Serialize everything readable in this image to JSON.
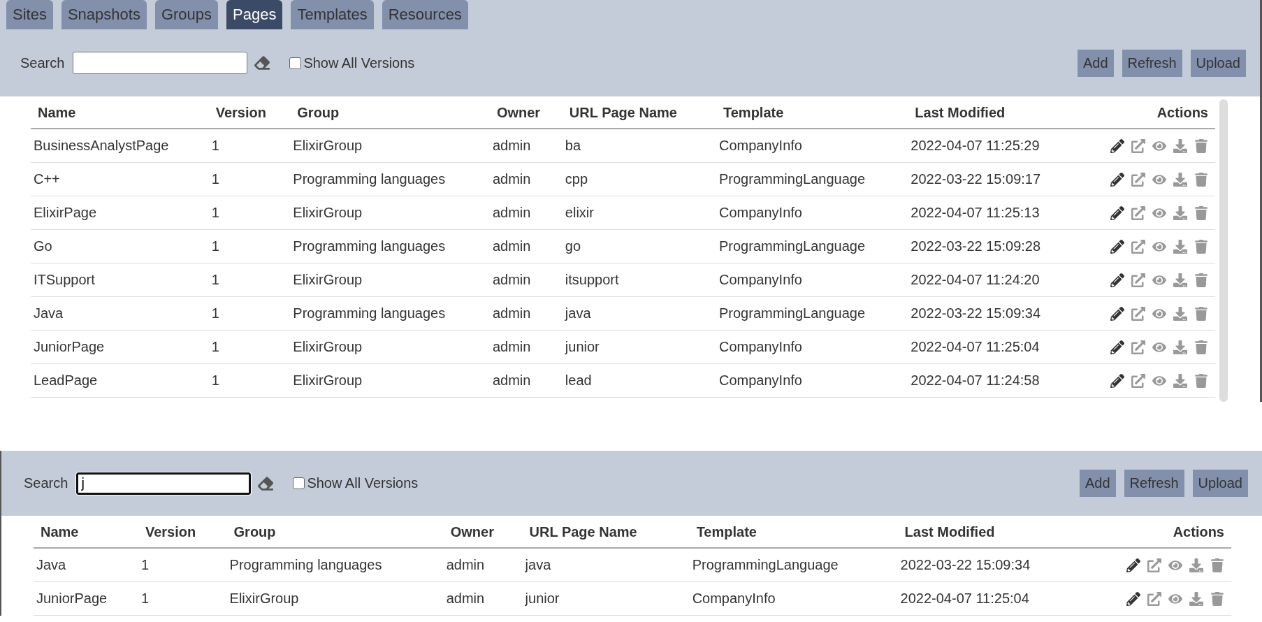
{
  "tabs": [
    {
      "label": "Sites",
      "selected": false
    },
    {
      "label": "Snapshots",
      "selected": false
    },
    {
      "label": "Groups",
      "selected": false
    },
    {
      "label": "Pages",
      "selected": true
    },
    {
      "label": "Templates",
      "selected": false
    },
    {
      "label": "Resources",
      "selected": false
    }
  ],
  "panels": [
    {
      "search_label": "Search",
      "search": {
        "focused": false
      },
      "show_all": {
        "label": "Show All Versions",
        "checked": false
      },
      "buttons": [
        "Add",
        "Refresh",
        "Upload"
      ],
      "scrollbar": true,
      "columns": [
        "Name",
        "Version",
        "Group",
        "Owner",
        "URL Page Name",
        "Template",
        "Last Modified",
        "Actions"
      ],
      "rows": [
        {
          "cells": [
            "BusinessAnalystPage",
            "1",
            "ElixirGroup",
            "admin",
            "ba",
            "CompanyInfo",
            "2022-04-07 11:25:29"
          ]
        },
        {
          "cells": [
            "C++",
            "1",
            "Programming languages",
            "admin",
            "cpp",
            "ProgrammingLanguage",
            "2022-03-22 15:09:17"
          ]
        },
        {
          "cells": [
            "ElixirPage",
            "1",
            "ElixirGroup",
            "admin",
            "elixir",
            "CompanyInfo",
            "2022-04-07 11:25:13"
          ]
        },
        {
          "cells": [
            "Go",
            "1",
            "Programming languages",
            "admin",
            "go",
            "ProgrammingLanguage",
            "2022-03-22 15:09:28"
          ]
        },
        {
          "cells": [
            "ITSupport",
            "1",
            "ElixirGroup",
            "admin",
            "itsupport",
            "CompanyInfo",
            "2022-04-07 11:24:20"
          ]
        },
        {
          "cells": [
            "Java",
            "1",
            "Programming languages",
            "admin",
            "java",
            "ProgrammingLanguage",
            "2022-03-22 15:09:34"
          ]
        },
        {
          "cells": [
            "JuniorPage",
            "1",
            "ElixirGroup",
            "admin",
            "junior",
            "CompanyInfo",
            "2022-04-07 11:25:04"
          ]
        },
        {
          "cells": [
            "LeadPage",
            "1",
            "ElixirGroup",
            "admin",
            "lead",
            "CompanyInfo",
            "2022-04-07 11:24:58"
          ]
        }
      ]
    },
    {
      "search_label": "Search",
      "search": {
        "value": "j",
        "focused": true
      },
      "show_all": {
        "label": "Show All Versions",
        "checked": false
      },
      "buttons": [
        "Add",
        "Refresh",
        "Upload"
      ],
      "scrollbar": false,
      "columns": [
        "Name",
        "Version",
        "Group",
        "Owner",
        "URL Page Name",
        "Template",
        "Last Modified",
        "Actions"
      ],
      "rows": [
        {
          "cells": [
            "Java",
            "1",
            "Programming languages",
            "admin",
            "java",
            "ProgrammingLanguage",
            "2022-03-22 15:09:34"
          ]
        },
        {
          "cells": [
            "JuniorPage",
            "1",
            "ElixirGroup",
            "admin",
            "junior",
            "CompanyInfo",
            "2022-04-07 11:25:04"
          ]
        }
      ]
    }
  ]
}
